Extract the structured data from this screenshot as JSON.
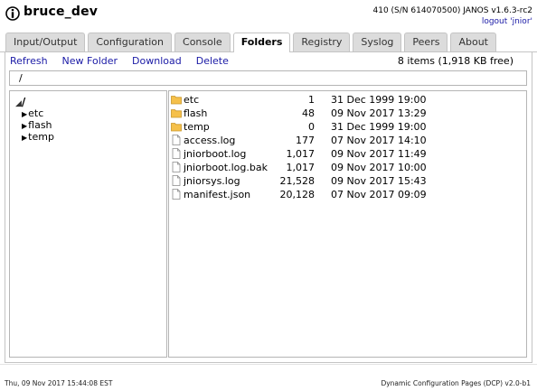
{
  "header": {
    "device_name": "bruce_dev",
    "device_info": "410 (S/N 614070500) JANOS v1.6.3-rc2",
    "logout": "logout 'jnior'"
  },
  "tabs": [
    {
      "label": "Input/Output"
    },
    {
      "label": "Configuration"
    },
    {
      "label": "Console"
    },
    {
      "label": "Folders"
    },
    {
      "label": "Registry"
    },
    {
      "label": "Syslog"
    },
    {
      "label": "Peers"
    },
    {
      "label": "About"
    }
  ],
  "active_tab": "Folders",
  "toolbar": {
    "refresh": "Refresh",
    "new_folder": "New Folder",
    "download": "Download",
    "delete": "Delete",
    "items_info": "8 items (1,918 KB free)"
  },
  "path": "/",
  "tree": {
    "root": "/",
    "items": [
      {
        "label": "etc"
      },
      {
        "label": "flash"
      },
      {
        "label": "temp"
      }
    ]
  },
  "files": [
    {
      "name": "etc",
      "type": "folder",
      "size": "1",
      "date": "31 Dec 1999 19:00"
    },
    {
      "name": "flash",
      "type": "folder",
      "size": "48",
      "date": "09 Nov 2017 13:29"
    },
    {
      "name": "temp",
      "type": "folder",
      "size": "0",
      "date": "31 Dec 1999 19:00"
    },
    {
      "name": "access.log",
      "type": "file",
      "size": "177",
      "date": "07 Nov 2017 14:10"
    },
    {
      "name": "jniorboot.log",
      "type": "file",
      "size": "1,017",
      "date": "09 Nov 2017 11:49"
    },
    {
      "name": "jniorboot.log.bak",
      "type": "file",
      "size": "1,017",
      "date": "09 Nov 2017 10:00"
    },
    {
      "name": "jniorsys.log",
      "type": "file",
      "size": "21,528",
      "date": "09 Nov 2017 15:43"
    },
    {
      "name": "manifest.json",
      "type": "file",
      "size": "20,128",
      "date": "07 Nov 2017 09:09"
    }
  ],
  "footer": {
    "timestamp": "Thu, 09 Nov 2017 15:44:08 EST",
    "version": "Dynamic Configuration Pages (DCP) v2.0-b1"
  },
  "colors": {
    "link": "#1a1aa6",
    "folder": "#f5c04a",
    "tab_bg": "#dcdcdc"
  }
}
